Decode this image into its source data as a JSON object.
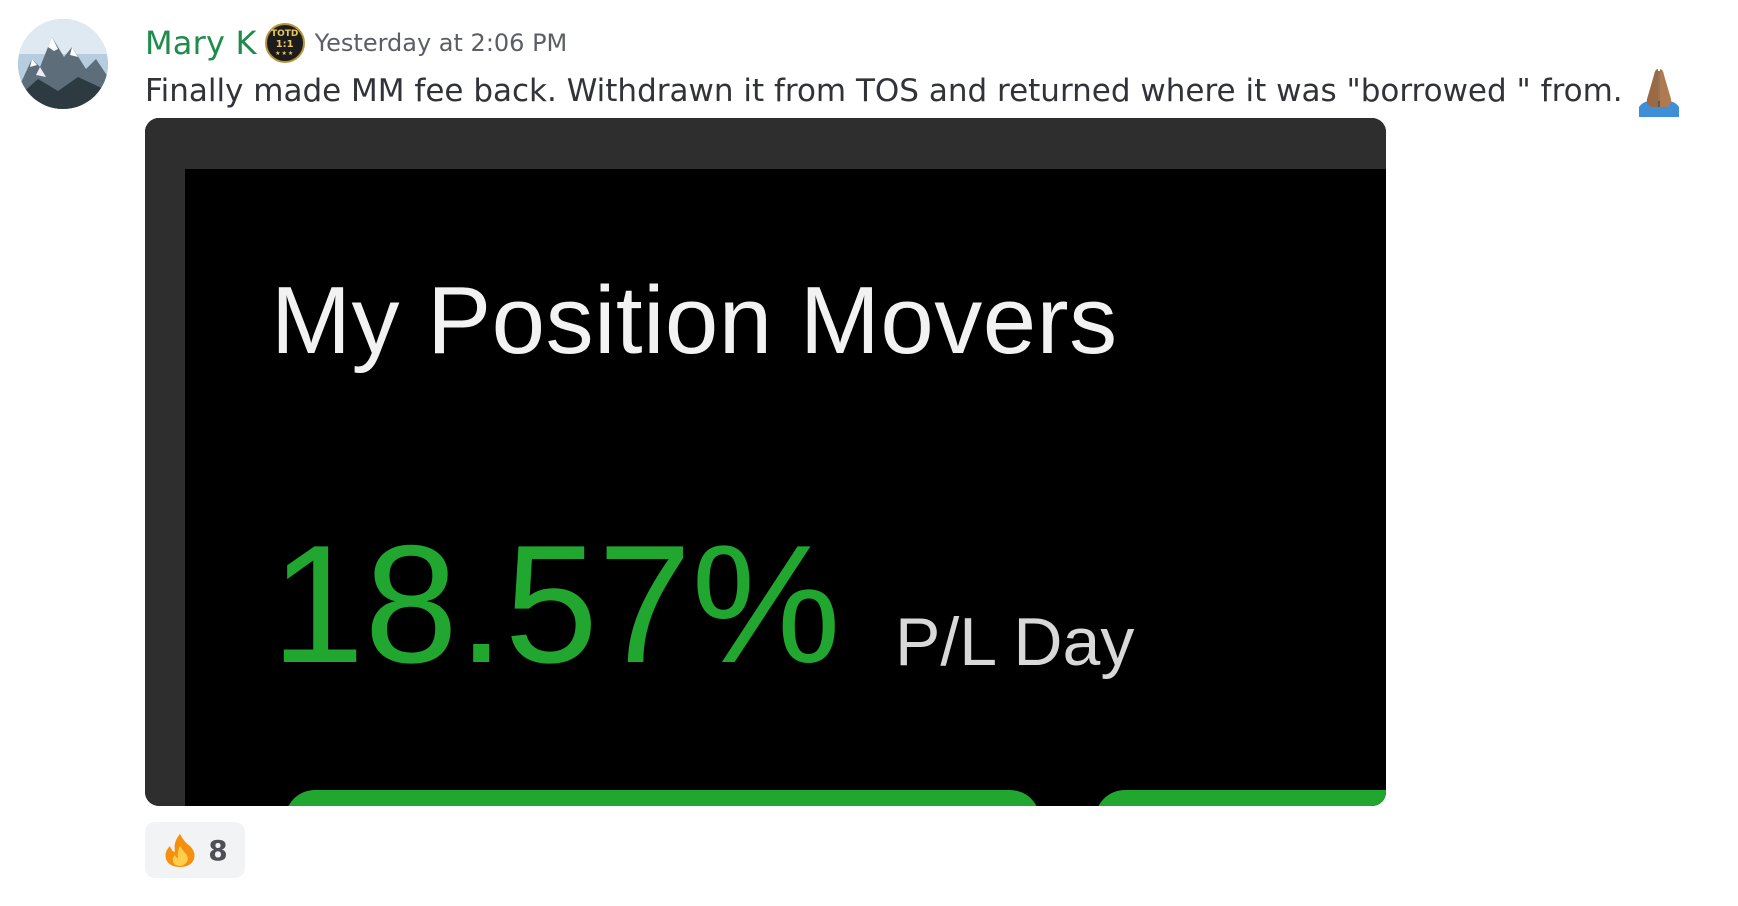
{
  "message": {
    "author": {
      "name": "Mary K",
      "name_color": "#1f8b4c",
      "avatar_icon": "mountain-avatar",
      "role_badge": {
        "line1": "TOTD",
        "line2": "1:1",
        "line3": "★★★"
      }
    },
    "timestamp": "Yesterday at 2:06 PM",
    "text": "Finally made MM fee back. Withdrawn it from TOS and returned where it was \"borrowed \" from.",
    "trailing_emoji": "folded-hands-icon",
    "attachment": {
      "title": "My Position Movers",
      "value": "18.57%",
      "unit": "P/L Day",
      "value_color": "#21a62f"
    },
    "reactions": [
      {
        "emoji": "fire-icon",
        "count": "8"
      }
    ]
  }
}
